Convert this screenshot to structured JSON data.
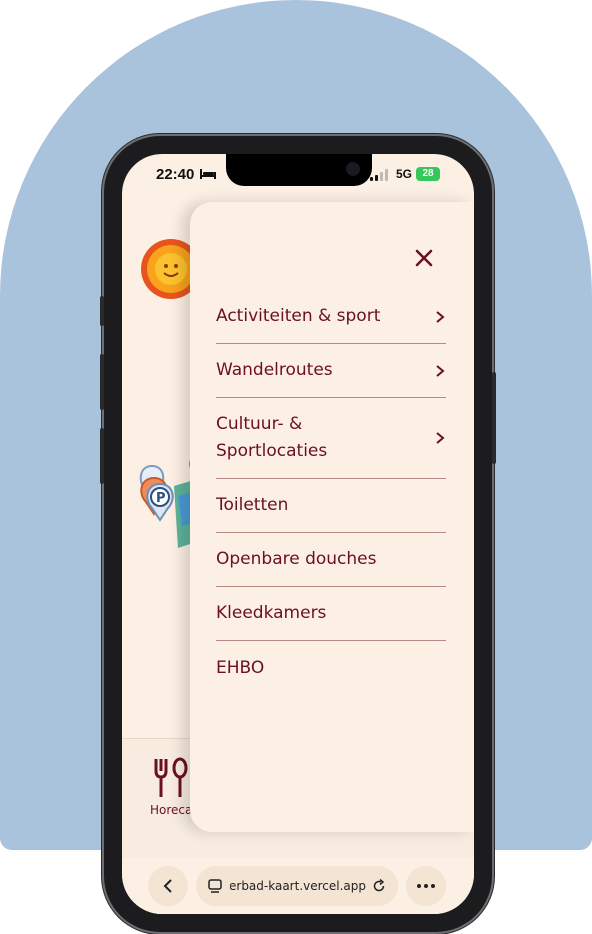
{
  "status_bar": {
    "time": "22:40",
    "network": "5G",
    "battery": "28"
  },
  "menu": {
    "close_icon": "close-icon",
    "items": [
      {
        "label": "Activiteiten & sport",
        "has_submenu": true
      },
      {
        "label": "Wandelroutes",
        "has_submenu": true
      },
      {
        "label": "Cultuur- & Sportlocaties",
        "has_submenu": true
      },
      {
        "label": "Toiletten",
        "has_submenu": false
      },
      {
        "label": "Openbare douches",
        "has_submenu": false
      },
      {
        "label": "Kleedkamers",
        "has_submenu": false
      },
      {
        "label": "EHBO",
        "has_submenu": false
      }
    ]
  },
  "bottom_nav": {
    "horeca_label": "Horeca"
  },
  "browser": {
    "url": "zuiderbad-kaart.vercel.app"
  },
  "colors": {
    "background_arch": "#a9c3dc",
    "app_background": "#fcefe3",
    "accent": "#6b1020",
    "divider": "#b88a86"
  }
}
